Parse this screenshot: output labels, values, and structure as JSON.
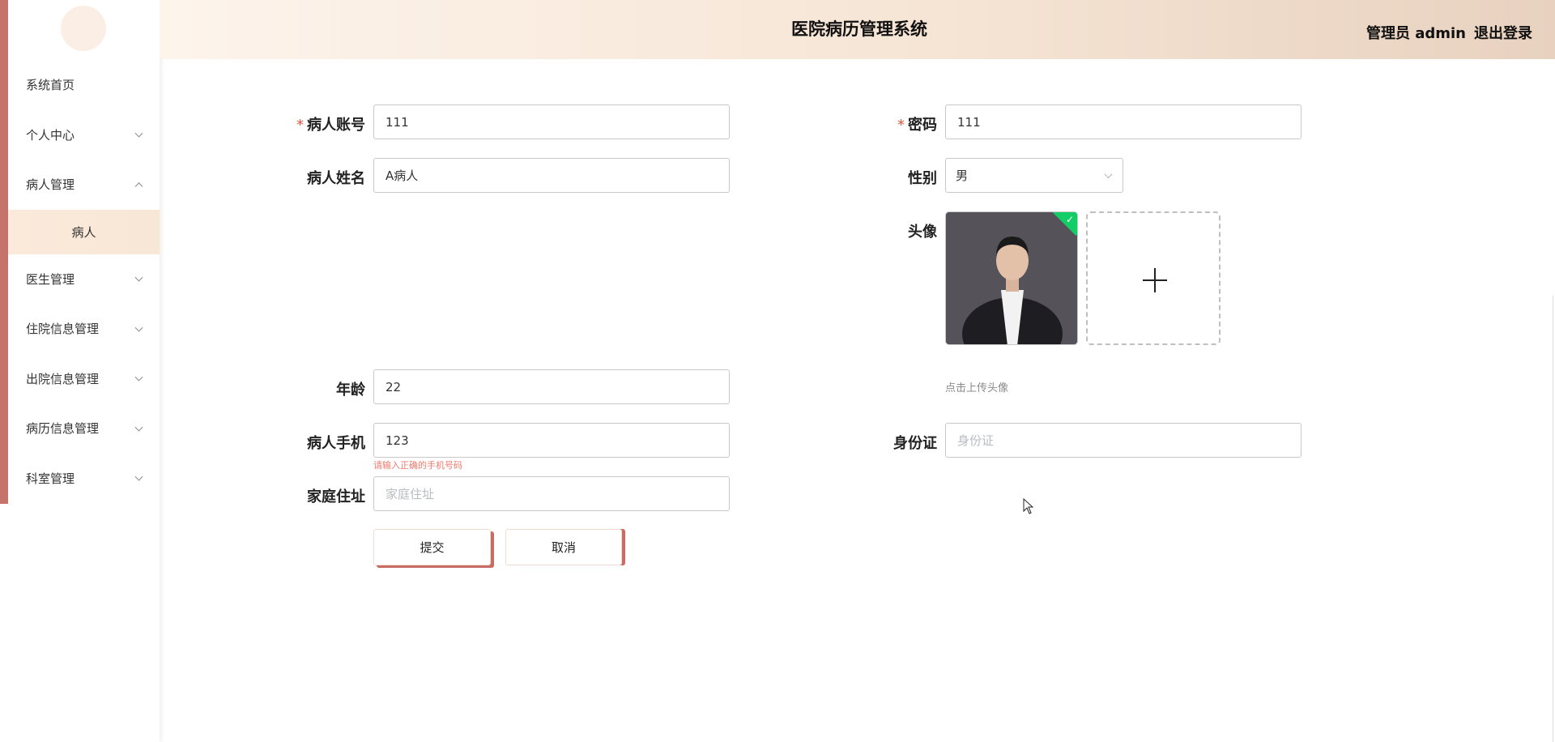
{
  "header": {
    "title": "医院病历管理系统",
    "user": "管理员 admin",
    "logout": "退出登录"
  },
  "sidebar": {
    "items": [
      {
        "label": "系统首页",
        "expandable": false
      },
      {
        "label": "个人中心",
        "expandable": true
      },
      {
        "label": "病人管理",
        "expandable": true,
        "expanded": true
      },
      {
        "label": "医生管理",
        "expandable": true
      },
      {
        "label": "住院信息管理",
        "expandable": true
      },
      {
        "label": "出院信息管理",
        "expandable": true
      },
      {
        "label": "病历信息管理",
        "expandable": true
      },
      {
        "label": "科室管理",
        "expandable": true
      }
    ],
    "submenu": {
      "label": "病人"
    }
  },
  "form": {
    "account": {
      "label": "病人账号",
      "required": "*",
      "value": "111"
    },
    "password": {
      "label": "密码",
      "required": "*",
      "value": "111"
    },
    "name": {
      "label": "病人姓名",
      "value": "A病人"
    },
    "gender": {
      "label": "性别",
      "value": "男"
    },
    "avatar": {
      "label": "头像",
      "hint": "点击上传头像"
    },
    "age": {
      "label": "年龄",
      "value": "22"
    },
    "phone": {
      "label": "病人手机",
      "value": "123",
      "error": "请输入正确的手机号码"
    },
    "id_card": {
      "label": "身份证",
      "placeholder": "身份证"
    },
    "address": {
      "label": "家庭住址",
      "placeholder": "家庭住址"
    },
    "submit": "提交",
    "cancel": "取消"
  },
  "colors": {
    "accent": "#c5736b",
    "error": "#f07a6e",
    "success": "#13ce66"
  }
}
